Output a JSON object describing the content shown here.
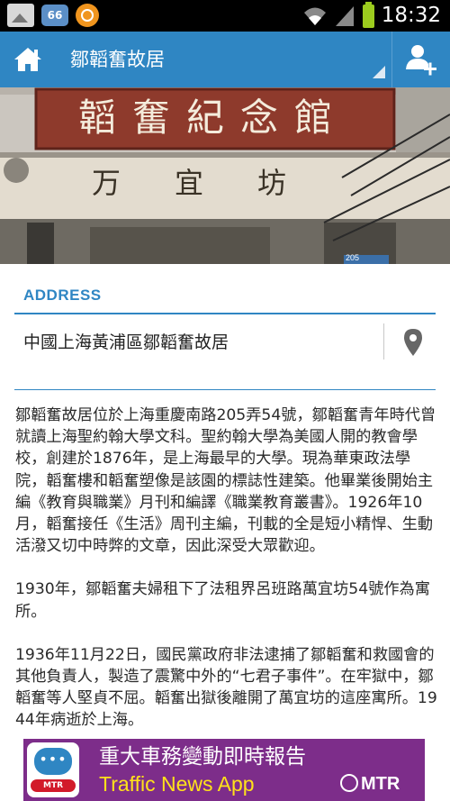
{
  "status_bar": {
    "badge": "66",
    "time": "18:32",
    "icons": [
      "image-icon",
      "notification-badge-icon",
      "app-circle-icon",
      "wifi-icon",
      "signal-icon",
      "battery-icon"
    ]
  },
  "action_bar": {
    "title": "鄒韜奮故居",
    "home_icon": "home-icon",
    "add_user_icon": "add-user-icon"
  },
  "photo": {
    "sign_main": "韜奮紀念館",
    "sign_sub": "万宜坊",
    "plate": "205"
  },
  "address": {
    "label": "ADDRESS",
    "value": "中國上海黃浦區鄒韜奮故居",
    "map_icon": "map-pin-icon"
  },
  "description": [
    "鄒韜奮故居位於上海重慶南路205弄54號，鄒韜奮青年時代曾就讀上海聖約翰大學文科。聖約翰大學為美國人開的教會學校，創建於1876年，是上海最早的大學。現為華東政法學院，韜奮樓和韜奮塑像是該園的標誌性建築。他畢業後開始主編《教育與職業》月刊和編譯《職業教育叢書》。1926年10月，韜奮接任《生活》周刊主編，刊載的全是短小精悍、生動活潑又切中時弊的文章，因此深受大眾歡迎。",
    "1930年，鄒韜奮夫婦租下了法租界呂班路萬宜坊54號作為寓所。",
    "1936年11月22日，國民黨政府非法逮捕了鄒韜奮和救國會的其他負責人，製造了震驚中外的“七君子事件”。在牢獄中，鄒韜奮等人堅貞不屈。韜奮出獄後離開了萬宜坊的這座寓所。1944年病逝於上海。"
  ],
  "ad": {
    "title_zh": "重大車務變動即時報告",
    "title_en": "Traffic News App",
    "brand": "MTR",
    "icon_brand": "MTR",
    "background": "#7d2d8a",
    "accent": "#ffe11a"
  },
  "colors": {
    "action_bar": "#2f86c3",
    "accent": "#2f86c3",
    "status_bar": "#000000"
  }
}
